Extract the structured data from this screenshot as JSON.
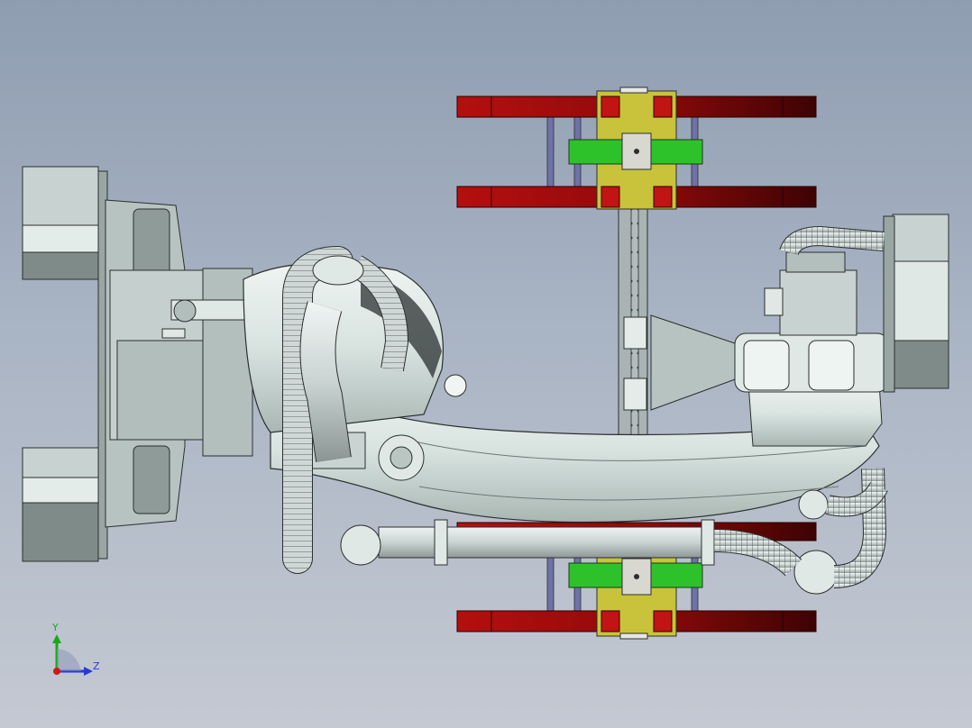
{
  "viewport": {
    "background_top": "#8f9db1",
    "background_bottom": "#c4c9d2"
  },
  "colors": {
    "body_fill": "#dfe8e5",
    "body_shade": "#b9c6c2",
    "body_edge": "#2b2f2f",
    "box_fill": "#bcc8c6",
    "box_dark": "#7f8b88",
    "hose_fill": "#cfd8d6",
    "hose_rib": "#5b6462",
    "wheel_red": "#a40d0d",
    "wheel_dark": "#4a0606",
    "hub_yellow": "#c8c33a",
    "bracket_green": "#2ec22a",
    "rod_blue": "#6f72a8",
    "rail_gray": "#a9b3b3",
    "axis_x": "#2b38d6",
    "axis_y": "#1aa81a",
    "axis_origin": "#d01818"
  },
  "triad": {
    "y_label": "Y",
    "z_label": "Z",
    "icon": "coordinate-triad-icon"
  }
}
